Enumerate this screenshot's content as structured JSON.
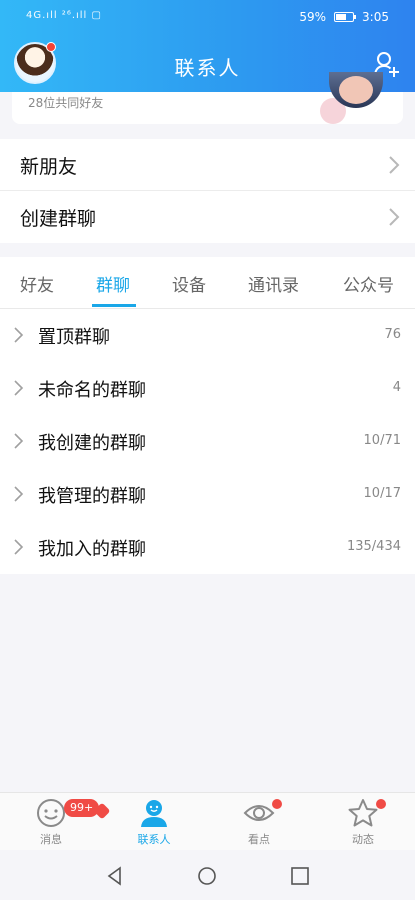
{
  "status_bar": {
    "signal_left": "4G.ıll ²⁶.ıll ▢",
    "battery_percent": "59%",
    "time": "3:05"
  },
  "header": {
    "title": "联系人",
    "avatar_icon": "user-avatar",
    "add_friend_icon": "add-friend-icon"
  },
  "partial_card": {
    "mutual_friends": "28位共同好友"
  },
  "quick_rows": [
    {
      "label": "新朋友"
    },
    {
      "label": "创建群聊"
    }
  ],
  "tabs": [
    {
      "label": "好友"
    },
    {
      "label": "群聊"
    },
    {
      "label": "设备"
    },
    {
      "label": "通讯录"
    },
    {
      "label": "公众号"
    }
  ],
  "group_list": [
    {
      "label": "置顶群聊",
      "count": "76"
    },
    {
      "label": "未命名的群聊",
      "count": "4"
    },
    {
      "label": "我创建的群聊",
      "count": "10/71"
    },
    {
      "label": "我管理的群聊",
      "count": "10/17"
    },
    {
      "label": "我加入的群聊",
      "count": "135/434"
    }
  ],
  "bottom_nav": {
    "messages": {
      "label": "消息",
      "badge": "99+"
    },
    "contacts": {
      "label": "联系人"
    },
    "watch": {
      "label": "看点"
    },
    "moments": {
      "label": "动态"
    }
  },
  "colors": {
    "accent": "#1aa7e8",
    "header_left": "#33b8f7",
    "header_right": "#2e83ef",
    "badge": "#f04b45"
  }
}
